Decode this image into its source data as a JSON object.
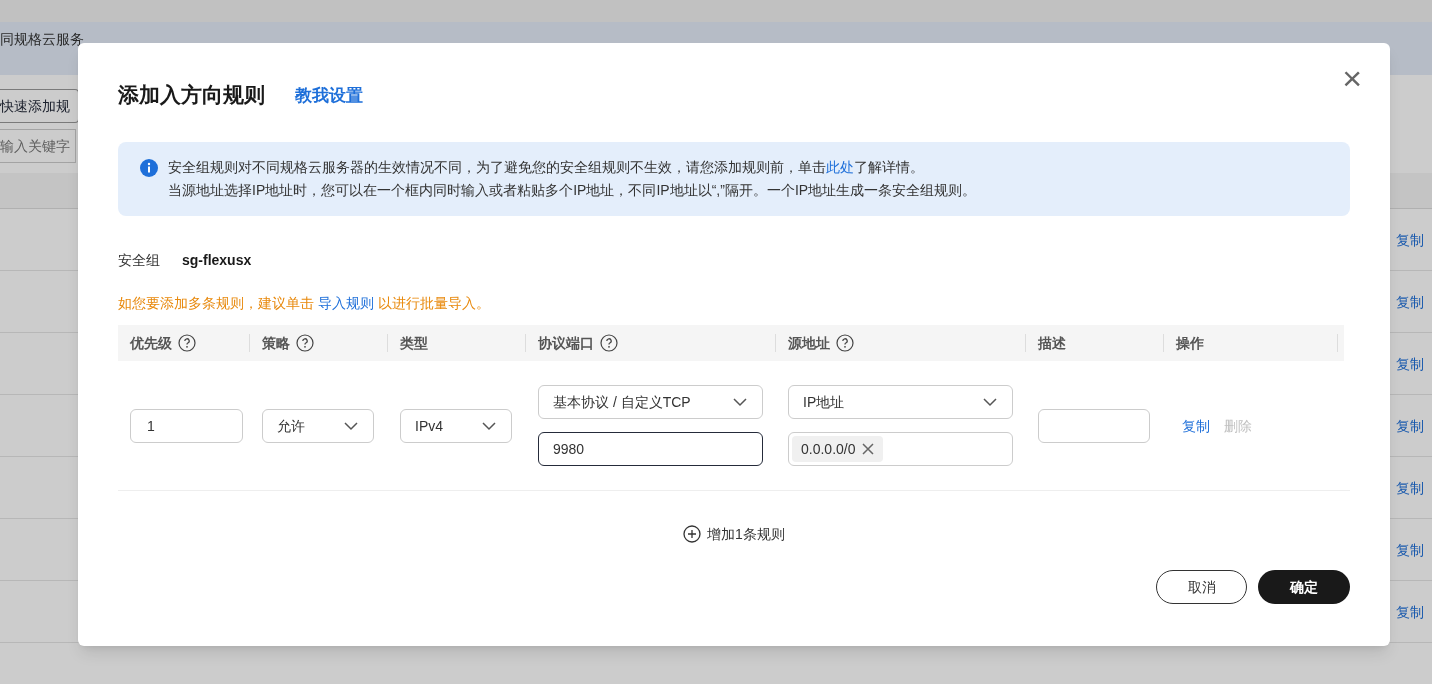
{
  "background": {
    "banner_text": "同规格云服务",
    "quick_add_button": "快速添加规",
    "search": {
      "placeholder": "输入关键字"
    },
    "row_actions": [
      "复制",
      "复制",
      "复制",
      "复制",
      "复制",
      "复制",
      "复制"
    ]
  },
  "dialog": {
    "title": "添加入方向规则",
    "help_link": "教我设置",
    "close": "×",
    "notice": {
      "line_1": {
        "before": "安全组规则对不同规格云服务器的生效情况不同，为了避免您的安全组规则不生效，请您添加规则前，单击",
        "link": "此处",
        "after": "了解详情。"
      },
      "line_2": "当源地址选择IP地址时，您可以在一个框内同时输入或者粘贴多个IP地址，不同IP地址以“,”隔开。一个IP地址生成一条安全组规则。"
    },
    "security_group": {
      "label": "安全组",
      "value": "sg-flexusx"
    },
    "tip": {
      "before": "如您要添加多条规则，建议单击 ",
      "link": "导入规则",
      "after": " 以进行批量导入。"
    },
    "table": {
      "columns": [
        {
          "label": "优先级",
          "help": true
        },
        {
          "label": "策略",
          "help": true
        },
        {
          "label": "类型",
          "help": false
        },
        {
          "label": "协议端口",
          "help": true
        },
        {
          "label": "源地址",
          "help": true
        },
        {
          "label": "描述",
          "help": false
        },
        {
          "label": "操作",
          "help": false
        }
      ],
      "rows": [
        {
          "priority": "1",
          "policy": "允许",
          "type": "IPv4",
          "protocol": "基本协议 / 自定义TCP",
          "port": "9980",
          "source_type": "IP地址",
          "source_tags": [
            "0.0.0.0/0"
          ],
          "actions": [
            {
              "label": "复制",
              "disabled": false
            },
            {
              "label": "删除",
              "disabled": true
            }
          ]
        }
      ]
    },
    "add_rule": "增加1条规则",
    "buttons": [
      {
        "label": "取消",
        "primary": false
      },
      {
        "label": "确定",
        "primary": true
      }
    ]
  }
}
